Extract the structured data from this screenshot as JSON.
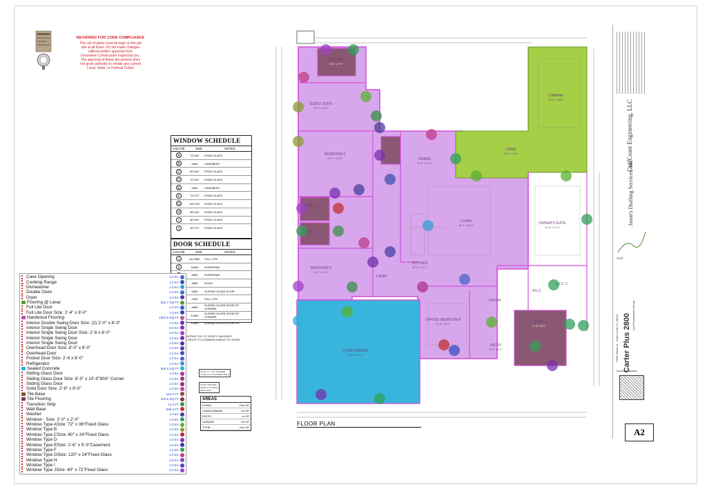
{
  "review_stamp": {
    "logo_text": "INNOVATIVE CONSTRUCTION INSPECTION",
    "title": "REVIEWED FOR CODE COMPLIANCE",
    "lines": [
      "This set of plans must be kept on the job",
      "site at all times. Do not make changes",
      "without written approval from",
      "Innovative Construction Inspection Inc.",
      "The approval of these documents does",
      "not grant authority to violate any current",
      "Local, State, or Federal Codes"
    ]
  },
  "window_schedule": {
    "title": "WINDOW SCHEDULE",
    "headers": [
      "LOCATE",
      "SIZE",
      "NOTES"
    ],
    "rows": [
      {
        "id": "A",
        "size": "72\"x36\"",
        "notes": "FIXED GLASS"
      },
      {
        "id": "B",
        "size": "2660",
        "notes": "CASEMENT"
      },
      {
        "id": "C",
        "size": "60\"x24\"",
        "notes": "FIXED GLASS"
      },
      {
        "id": "D",
        "size": "72\"x24\"",
        "notes": "FIXED GLASS"
      },
      {
        "id": "E",
        "size": "2650",
        "notes": "CASEMENT"
      },
      {
        "id": "F",
        "size": "72\"x72\"",
        "notes": "FIXED GLASS"
      },
      {
        "id": "G",
        "size": "120\"x24\"",
        "notes": "FIXED GLASS"
      },
      {
        "id": "H",
        "size": "36\"x18\"",
        "notes": "FIXED GLASS"
      },
      {
        "id": "I",
        "size": "80\"x24\"",
        "notes": "FIXED GLASS"
      },
      {
        "id": "J",
        "size": "40\"x72\"",
        "notes": "FIXED GLASS"
      }
    ]
  },
  "door_schedule": {
    "title": "DOOR SCHEDULE",
    "headers": [
      "LOCATE",
      "SIZE",
      "NOTES"
    ],
    "rows": [
      {
        "id": "1",
        "size": "(2) 3080",
        "notes": "FULL LITE"
      },
      {
        "id": "2",
        "size": "16080",
        "notes": "OVERHEAD"
      },
      {
        "id": "3",
        "size": "8080",
        "notes": "OVERHEAD"
      },
      {
        "id": "4",
        "size": "2880",
        "notes": "SOLID"
      },
      {
        "id": "5",
        "size": "6080",
        "notes": "SLIDING GLASS DOOR"
      },
      {
        "id": "6",
        "size": "2480",
        "notes": "FULL LITE"
      },
      {
        "id": "7",
        "size": "8080",
        "notes": "SLIDING GLASS DOOR 90° CORNER"
      },
      {
        "id": "8",
        "size": "12080",
        "notes": "SLIDING GLASS DOOR 90° CORNER"
      },
      {
        "id": "9",
        "size": "12080",
        "notes": "SLIDING GLASS DOOR FKT"
      }
    ]
  },
  "legend": [
    {
      "icon": "dash",
      "label": "Case Opening",
      "qty": "2.0 EA",
      "color": "#4a63c8"
    },
    {
      "icon": "dash",
      "label": "Cooking Range",
      "qty": "1.0 EA",
      "color": "#3c4fb0"
    },
    {
      "icon": "dash",
      "label": "Dishwasher",
      "qty": "1.0 EA",
      "color": "#35a0d6"
    },
    {
      "icon": "dash",
      "label": "Double Oven",
      "qty": "1.0 EA",
      "color": "#3b72c4"
    },
    {
      "icon": "dash",
      "label": "Dryer",
      "qty": "1.0 EA",
      "color": "#4a3fa6"
    },
    {
      "icon": "sq",
      "label": "Flooring @ Lanai",
      "qty": "522.7 SQ FT",
      "color": "#5aa02c"
    },
    {
      "icon": "dash",
      "label": "Full Lite Door",
      "qty": "1.0 EA",
      "color": "#2f5bd2"
    },
    {
      "icon": "dash",
      "label": "Full Lite Door Size: 2'-4\" x 8'-0\"",
      "qty": "1.0 EA",
      "color": "#2f43a8"
    },
    {
      "icon": "sq",
      "label": "Hardwood Flooring",
      "qty": "2252.6 SQ FT",
      "color": "#c0509a"
    },
    {
      "icon": "dash",
      "label": "Interior Double Swing Door Size: (2) 2'-0\" x 8'-0\"",
      "qty": "1.0 EA",
      "color": "#6f2fa6"
    },
    {
      "icon": "dash",
      "label": "Interior Single Swing Door",
      "qty": "6.0 EA",
      "color": "#8a2fb8"
    },
    {
      "icon": "dash",
      "label": "Interior Single Swing Door Size: 2'-6 x 8'-0\"",
      "qty": "8.0 EA",
      "color": "#9a3fc8"
    },
    {
      "icon": "dash",
      "label": "Interior Single Swing Door",
      "qty": "1.0 EA",
      "color": "#7a2fa8"
    },
    {
      "icon": "dash",
      "label": "Interior Single Swing Door",
      "qty": "1.0 EA",
      "color": "#5a2f98"
    },
    {
      "icon": "dash",
      "label": "Overhead Door Size: 8'-0\" x 8'-0\"",
      "qty": "1.0 EA",
      "color": "#4a3fb0"
    },
    {
      "icon": "dash",
      "label": "Overhead Door",
      "qty": "1.0 EA",
      "color": "#3a4fc0"
    },
    {
      "icon": "dash",
      "label": "Pocket Door Size: 2'-6 x 8'-0\"",
      "qty": "1.0 EA",
      "color": "#5a5fc8"
    },
    {
      "icon": "dash",
      "label": "Refrigerator",
      "qty": "1.0 EA",
      "color": "#3a8fd0"
    },
    {
      "icon": "sq",
      "label": "Sealed Concrete",
      "qty": "553.5 SQ FT",
      "color": "#30b0d8"
    },
    {
      "icon": "dash",
      "label": "Sliding Glass Door",
      "qty": "1.0 EA",
      "color": "#b03090"
    },
    {
      "icon": "dash",
      "label": "Sliding Glass Door Size: 8'-0\" x 10'-0\"90Â° Corner",
      "qty": "1.0 EA",
      "color": "#a02f80"
    },
    {
      "icon": "dash",
      "label": "Sliding Glass Door",
      "qty": "1.0 EA",
      "color": "#9a2f70"
    },
    {
      "icon": "dash",
      "label": "Solid Door Size: 2'-8\" x 8'-0\"",
      "qty": "1.0 EA",
      "color": "#c03fa0"
    },
    {
      "icon": "sq",
      "label": "Tile Base",
      "qty": "164.0 FT",
      "color": "#8a4a2f"
    },
    {
      "icon": "sq",
      "label": "Tile Flooring",
      "qty": "222.6 SQ FT",
      "color": "#7a3f4a"
    },
    {
      "icon": "dash",
      "label": "Transition Strip",
      "qty": "11.2 FT",
      "color": "#3a8f4a"
    },
    {
      "icon": "dash",
      "label": "Wall Base",
      "qty": "596.4 FT",
      "color": "#c03030"
    },
    {
      "icon": "dash",
      "label": "Washer",
      "qty": "1.0 EA",
      "color": "#4a3f9a"
    },
    {
      "icon": "dash",
      "label": "Window - Size: 2'-0\" x 2'-0\"",
      "qty": "1.0 EA",
      "color": "#2fa05a"
    },
    {
      "icon": "dash",
      "label": "Window Type ASize: 72\" x 36\"Fixed Glass",
      "qty": "1.0 EA",
      "color": "#5ab02f"
    },
    {
      "icon": "dash",
      "label": "Window Type B",
      "qty": "1.0 EA",
      "color": "#8a9a2f"
    },
    {
      "icon": "dash",
      "label": "Window Type CSize: 60\" x 24\"Fixed Glass",
      "qty": "1.0 EA",
      "color": "#b0302f"
    },
    {
      "icon": "dash",
      "label": "Window Type D",
      "qty": "1.0 EA",
      "color": "#7a2fb0"
    },
    {
      "icon": "dash",
      "label": "Window Type ESize: 2'-6\" x 5'-0\"Casement",
      "qty": "4.0 EA",
      "color": "#2f3fa0"
    },
    {
      "icon": "dash",
      "label": "Window Type F",
      "qty": "1.0 EA",
      "color": "#3aa04a"
    },
    {
      "icon": "dash",
      "label": "Window Type GSize: 120\" x 24\"Fixed Glass",
      "qty": "1.0 EA",
      "color": "#c03f8a"
    },
    {
      "icon": "dash",
      "label": "Window Type H",
      "qty": "3.0 EA",
      "color": "#8a3fb8"
    },
    {
      "icon": "dash",
      "label": "Window Type I",
      "qty": "1.0 EA",
      "color": "#5a3fc0"
    },
    {
      "icon": "dash",
      "label": "Window Type JSize: 40\" x 72\"Fixed Glass",
      "qty": "3.0 EA",
      "color": "#a040c8"
    }
  ],
  "notes": {
    "masonry": "CONTRACTOR TO VERIFY MASONRY\nOS PRIOR TO COMMENCEMENT OF WORK",
    "bath_note": "NOTE: 17\" x 54\" SHOWER\nTO BE AN ACCESSIBLE BATH",
    "glass_note": "NOTE: PROVIDE\nSAFETY GLAZING\nPER CODE"
  },
  "rooms": [
    {
      "name": "POOL BATH",
      "dim": "8'-2\" x 7'-0\""
    },
    {
      "name": "GUEST SUITE",
      "dim": "12'-0\" x 13'-0\""
    },
    {
      "name": "BEDROOM 3",
      "dim": "12'-0\" x 12'-6\""
    },
    {
      "name": "BATH 3",
      "dim": ""
    },
    {
      "name": "BATH 2",
      "dim": ""
    },
    {
      "name": "BEDROOM 2",
      "dim": "12'-0\" x 12'-0\""
    },
    {
      "name": "LNDRY",
      "dim": ""
    },
    {
      "name": "DINING",
      "dim": "12'-0\" x 14'-4\""
    },
    {
      "name": "LIVING",
      "dim": "18'-0\" x 18'-0\""
    },
    {
      "name": "KITCHEN",
      "dim": "16'-0\" x 14'-4\""
    },
    {
      "name": "OWNER'S SUITE",
      "dim": "14'-0\" x 17'-0\""
    },
    {
      "name": "W.I.C. 2",
      "dim": ""
    },
    {
      "name": "W.I.C.",
      "dim": ""
    },
    {
      "name": "CABANA",
      "dim": "15'-0\" x 25'-8\""
    },
    {
      "name": "LANAI",
      "dim": "24'-0\" x 14'-0\""
    },
    {
      "name": "OFFICE/ BEDROOM 4",
      "dim": "11'-8\" x 12'-0\""
    },
    {
      "name": "FOYER",
      "dim": ""
    },
    {
      "name": "ENTRY",
      "dim": "10'-8\" x 6'-0\""
    },
    {
      "name": "BATH",
      "dim": "17'-8\" x 8'-0\""
    },
    {
      "name": "3 CAR GARAGE",
      "dim": "23'-4\" x 23'-0\""
    }
  ],
  "plan_title": "FLOOR PLAN",
  "areas": {
    "title": "AREAS",
    "rows": [
      {
        "label": "LIVING",
        "value": "2xxx SF"
      },
      {
        "label": "LANAI/CABANA",
        "value": "7xx SF"
      },
      {
        "label": "ENTRY",
        "value": "xx SF"
      },
      {
        "label": "GARAGE",
        "value": "7xx SF"
      },
      {
        "label": "TOTAL",
        "value": "xxxx SF"
      }
    ]
  },
  "title_block": {
    "engineer": "GulfCoast Engineering, LLC",
    "drafting": "Jason's Drafting Services, Inc.",
    "project_group": "Lux Development Group",
    "project_name": "Carter Plus 2800",
    "project_address": "5399 Tatum Ct - Cape Coral, FL 33904",
    "scale_label": "SCALE OF DRAWING",
    "sheet": "A2"
  }
}
